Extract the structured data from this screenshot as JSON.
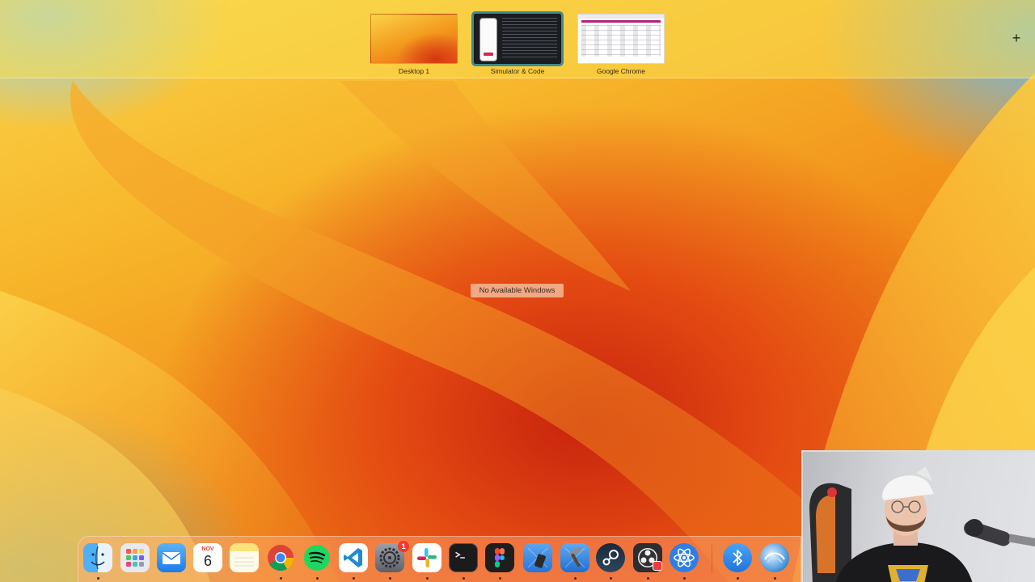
{
  "spaces": [
    {
      "name": "Desktop 1",
      "active": false
    },
    {
      "name": "Simulator & Code",
      "active": true
    },
    {
      "name": "Google Chrome",
      "active": false
    }
  ],
  "add_space_glyph": "+",
  "no_windows_label": "No Available Windows",
  "dock": {
    "apps": [
      {
        "name": "finder-icon",
        "running": true
      },
      {
        "name": "launchpad-icon",
        "running": false
      },
      {
        "name": "mail-icon",
        "running": false
      },
      {
        "name": "calendar-icon",
        "running": false
      },
      {
        "name": "notes-icon",
        "running": false
      },
      {
        "name": "chrome-icon",
        "running": true
      },
      {
        "name": "spotify-icon",
        "running": true
      },
      {
        "name": "vscode-icon",
        "running": true
      },
      {
        "name": "system-settings-icon",
        "running": true
      },
      {
        "name": "slack-icon",
        "running": true
      },
      {
        "name": "terminal-icon",
        "running": true
      },
      {
        "name": "figma-icon",
        "running": true
      },
      {
        "name": "xcode-simulator-icon",
        "running": false
      },
      {
        "name": "xcode-icon",
        "running": true
      },
      {
        "name": "steam-icon",
        "running": true
      },
      {
        "name": "obs-icon",
        "running": true
      },
      {
        "name": "electron-app-icon",
        "running": true
      },
      {
        "name": "bluetooth-icon",
        "running": true
      },
      {
        "name": "webcatalog-icon",
        "running": true
      }
    ],
    "calendar": {
      "month": "NOV",
      "day": "6"
    },
    "settings_badge": "1"
  },
  "colors": {
    "active_space_outline": "#3d8a8f",
    "badge": "#f2392b"
  }
}
